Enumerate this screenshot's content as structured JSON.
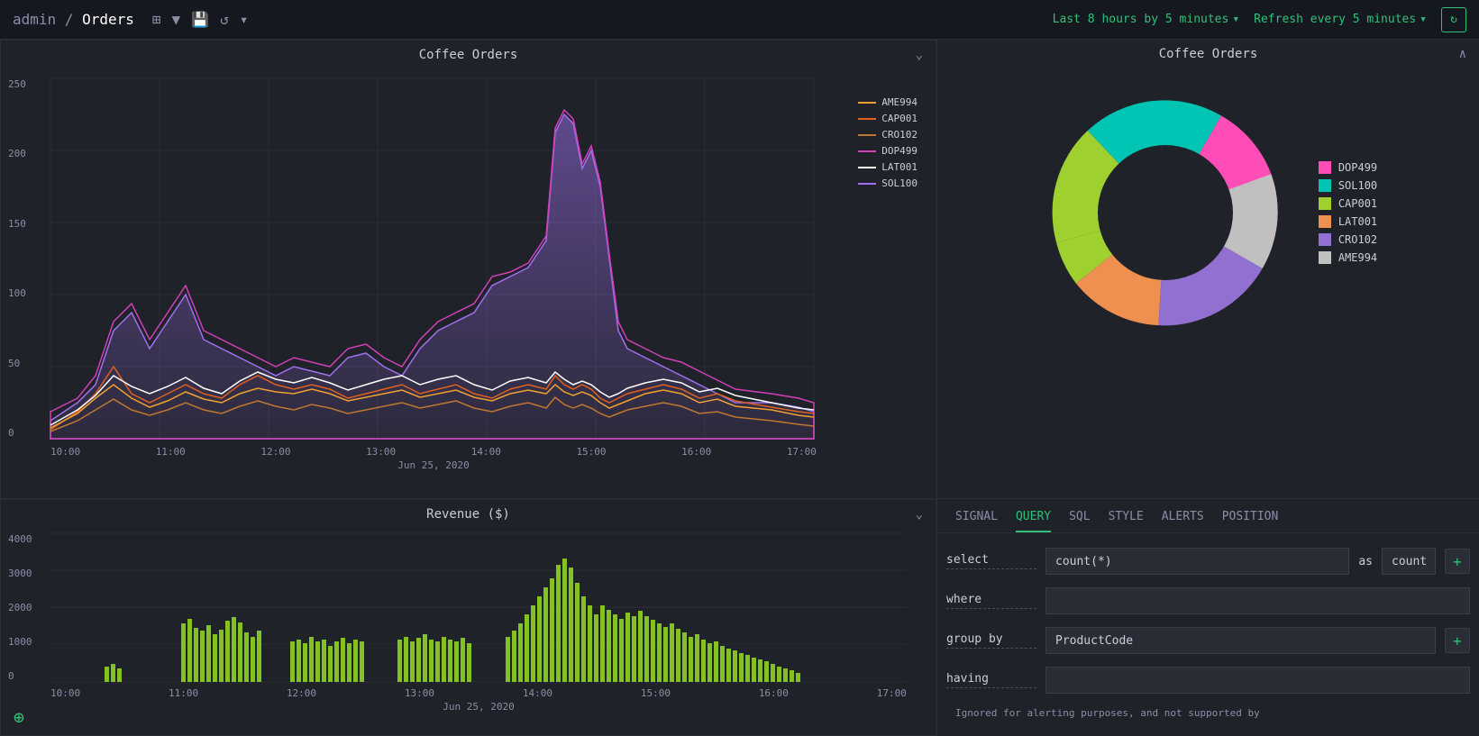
{
  "topbar": {
    "breadcrumb": "admin / Orders",
    "admin_label": "admin",
    "orders_label": "Orders",
    "time_range": "Last 8 hours by 5 minutes",
    "refresh_label": "Refresh every 5 minutes"
  },
  "panel_top": {
    "title": "Coffee Orders"
  },
  "panel_bottom": {
    "title": "Revenue ($)"
  },
  "right_panel": {
    "title": "Coffee Orders"
  },
  "legend_top": [
    {
      "label": "AME994",
      "color": "#f0a030"
    },
    {
      "label": "CAP001",
      "color": "#e06020"
    },
    {
      "label": "CRO102",
      "color": "#c07830"
    },
    {
      "label": "DOP499",
      "color": "#d040b8"
    },
    {
      "label": "LAT001",
      "color": "#ffffff"
    },
    {
      "label": "SOL100",
      "color": "#a070f0"
    }
  ],
  "donut_legend": [
    {
      "label": "DOP499",
      "color": "#ff4db8"
    },
    {
      "label": "SOL100",
      "color": "#00c4b4"
    },
    {
      "label": "CAP001",
      "color": "#a0d030"
    },
    {
      "label": "LAT001",
      "color": "#f09050"
    },
    {
      "label": "CRO102",
      "color": "#9070d0"
    },
    {
      "label": "AME994",
      "color": "#cccccc"
    }
  ],
  "tabs": [
    {
      "label": "SIGNAL",
      "active": false
    },
    {
      "label": "QUERY",
      "active": true
    },
    {
      "label": "SQL",
      "active": false
    },
    {
      "label": "STYLE",
      "active": false
    },
    {
      "label": "ALERTS",
      "active": false
    },
    {
      "label": "POSITION",
      "active": false
    }
  ],
  "query": {
    "select_label": "select",
    "select_value": "count(*)",
    "as_label": "as",
    "as_value": "count",
    "where_label": "where",
    "where_value": "",
    "group_by_label": "group by",
    "group_by_value": "ProductCode",
    "having_label": "having",
    "having_value": "",
    "note": "Ignored for alerting purposes, and not supported by"
  },
  "y_labels_top": [
    "0",
    "50",
    "100",
    "150",
    "200",
    "250"
  ],
  "x_labels_top": [
    "10:00",
    "11:00",
    "12:00",
    "13:00",
    "14:00",
    "15:00",
    "16:00",
    "17:00"
  ],
  "x_date_top": "Jun 25, 2020",
  "y_labels_bottom": [
    "0",
    "1000",
    "2000",
    "3000",
    "4000"
  ],
  "x_labels_bottom": [
    "10:00",
    "11:00",
    "12:00",
    "13:00",
    "14:00",
    "15:00",
    "16:00",
    "17:00"
  ],
  "x_date_bottom": "Jun 25, 2020"
}
